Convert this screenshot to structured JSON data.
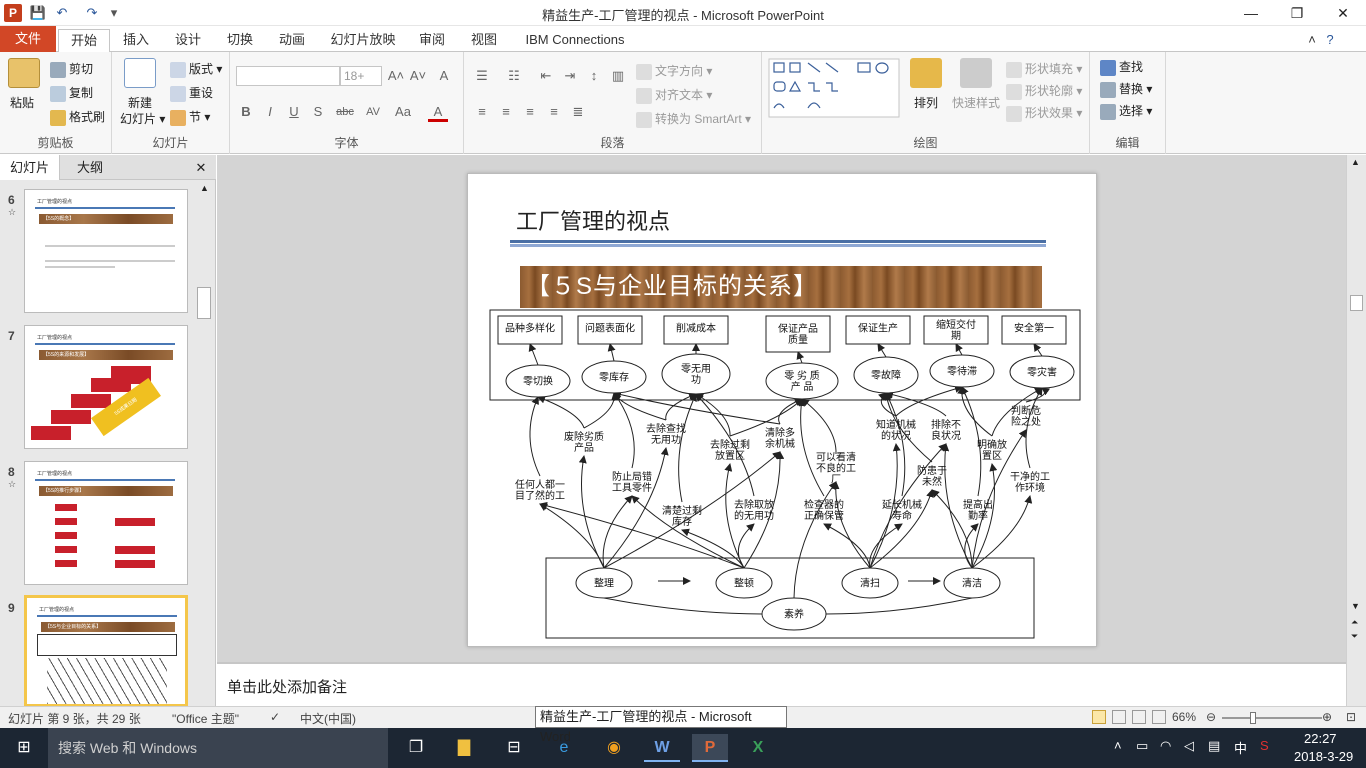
{
  "window": {
    "title": "精益生产-工厂管理的视点 - Microsoft PowerPoint",
    "app_letter": "P"
  },
  "qat": {
    "save": "💾",
    "undo": "↶",
    "redo": "↷",
    "more": "▾"
  },
  "controls": {
    "minimize": "—",
    "restore": "❐",
    "close": "✕"
  },
  "tabs": [
    "文件",
    "开始",
    "插入",
    "设计",
    "切换",
    "动画",
    "幻灯片放映",
    "审阅",
    "视图",
    "IBM Connections"
  ],
  "ribbon": {
    "clipboard": {
      "label": "剪贴板",
      "paste": "粘贴",
      "cut": "剪切",
      "copy": "复制",
      "format_painter": "格式刷"
    },
    "slides": {
      "label": "幻灯片",
      "new_slide": "新建\n幻灯片",
      "new_line1": "新建",
      "new_line2": "幻灯片 ▾",
      "layout": "版式 ▾",
      "reset": "重设",
      "section": "节 ▾"
    },
    "font": {
      "label": "字体",
      "font_name": "",
      "font_size": "18+",
      "bold": "B",
      "italic": "I",
      "underline": "U",
      "shadow": "S",
      "strike": "abc",
      "spacing": "AV",
      "case": "Aa",
      "color": "A",
      "grow": "A˄",
      "shrink": "A˅",
      "clear": "A"
    },
    "paragraph": {
      "label": "段落",
      "text_dir": "文字方向 ▾",
      "align_text": "对齐文本 ▾",
      "smartart": "转换为 SmartArt ▾"
    },
    "drawing": {
      "label": "绘图",
      "arrange": "排列",
      "quick_styles": "快速样式",
      "fill": "形状填充 ▾",
      "outline": "形状轮廓 ▾",
      "effects": "形状效果 ▾"
    },
    "editing": {
      "label": "编辑",
      "find": "查找",
      "replace": "替换 ▾",
      "select": "选择 ▾"
    }
  },
  "panel": {
    "tab_slides": "幻灯片",
    "tab_outline": "大纲",
    "close": "✕",
    "thumbs": [
      {
        "num": "6",
        "title": "工厂管理的视点",
        "banner": "【5S的概念】"
      },
      {
        "num": "7",
        "title": "工厂管理的视点",
        "banner": "【5S的来源和发展】",
        "arrow_text": "5S成果日期"
      },
      {
        "num": "8",
        "title": "工厂管理的视点",
        "banner": "【5S的推行步骤】"
      },
      {
        "num": "9",
        "title": "工厂管理的视点",
        "banner": "【5S与企业目标的关系】"
      }
    ]
  },
  "slide": {
    "title": "工厂管理的视点",
    "banner": "【５S与企业目标的关系】",
    "goals": [
      "品种多样化",
      "问题表面化",
      "削减成本",
      "保证产品\n质量",
      "保证生产",
      "缩短交付\n期",
      "安全第一"
    ],
    "zeros": [
      "零切换",
      "零库存",
      "零无用\n功",
      "零 劣 质\n产 品",
      "零故障",
      "零待滞",
      "零灾害"
    ],
    "middle": [
      "废除劣质\n产品",
      "去除查找\n无用功",
      "去除过剩\n放置区",
      "清除多\n余机械",
      "可以看清\n不良的工\n厂",
      "知道机械\n的状况",
      "排除不\n良状况",
      "明确放\n置区",
      "判断危\n险之处",
      "任何人都一\n目了然的工",
      "防止局错\n工具零件",
      "清楚过剩\n库存",
      "去除取放\n的无用功",
      "检查器的\n正确保管",
      "延长机械\n寿命",
      "防患于\n未然",
      "提高出\n勤率",
      "干净的工\n作环境"
    ],
    "fives": [
      "整理",
      "整顿",
      "清扫",
      "清洁",
      "素养"
    ]
  },
  "notes": {
    "placeholder": "单击此处添加备注"
  },
  "status": {
    "slide_info": "幻灯片 第 9 张，共 29 张",
    "theme": "\"Office 主题\"",
    "language": "中文(中国)",
    "zoom": "66%"
  },
  "tooltip": "精益生产-工厂管理的视点 - Microsoft Word",
  "taskbar": {
    "search": "搜索 Web 和 Windows",
    "ime": "中",
    "time": "22:27",
    "date": "2018-3-29"
  }
}
